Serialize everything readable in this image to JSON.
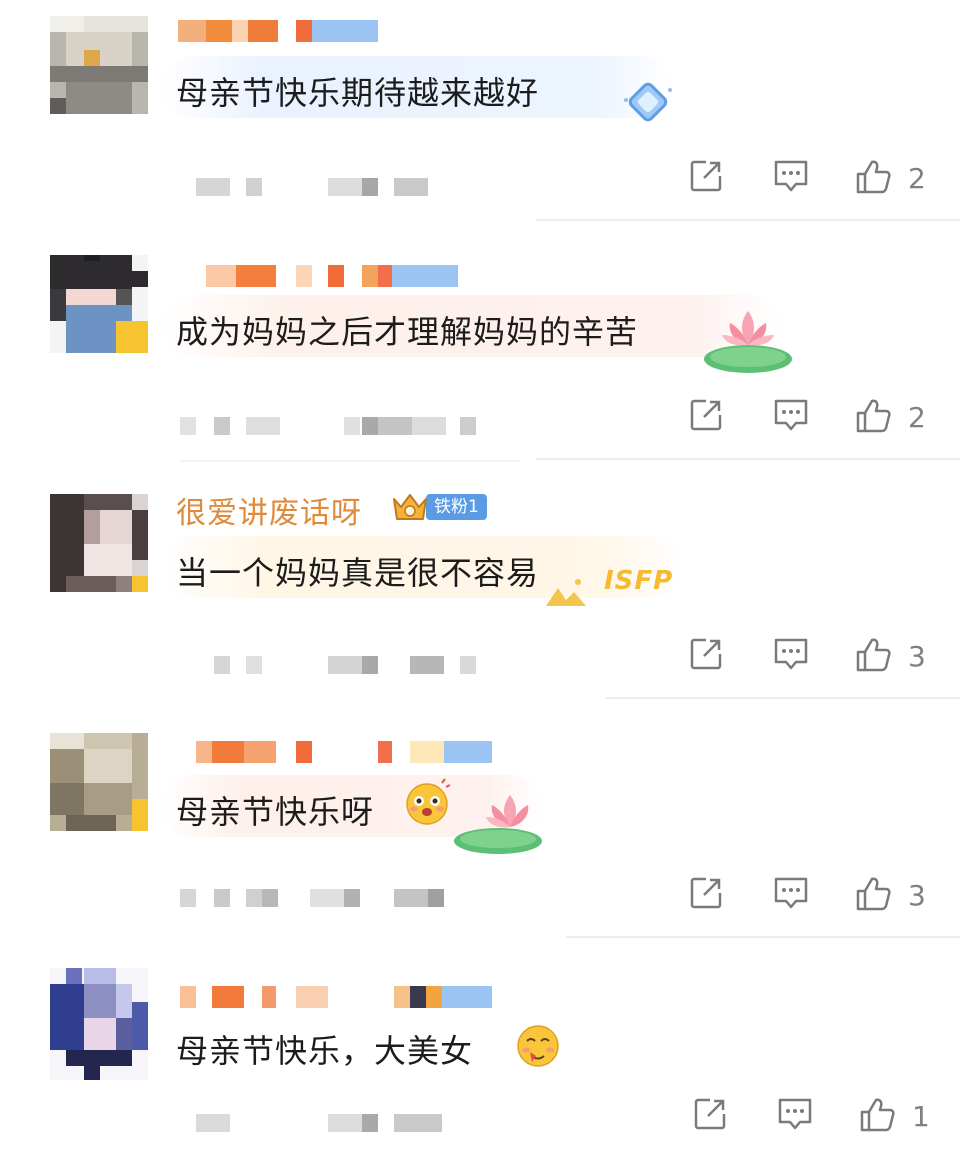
{
  "comments": [
    {
      "text": "母亲节快乐期待越来越好",
      "likes": "2"
    },
    {
      "text": "成为妈妈之后才理解妈妈的辛苦",
      "likes": "2"
    },
    {
      "username": "很爱讲废话呀",
      "fan_badge": "铁粉1",
      "text": "当一个妈妈真是很不容易",
      "sticker": "ISFP",
      "likes": "3"
    },
    {
      "text": "母亲节快乐呀",
      "likes": "3"
    },
    {
      "text": "母亲节快乐，大美女",
      "likes": "1"
    }
  ],
  "icons": {
    "share": "share-icon",
    "comment": "comment-icon",
    "like": "thumbs-up-icon"
  },
  "colors": {
    "username": "#e08a3c",
    "badge": "#5a9be6",
    "count": "#808080"
  }
}
